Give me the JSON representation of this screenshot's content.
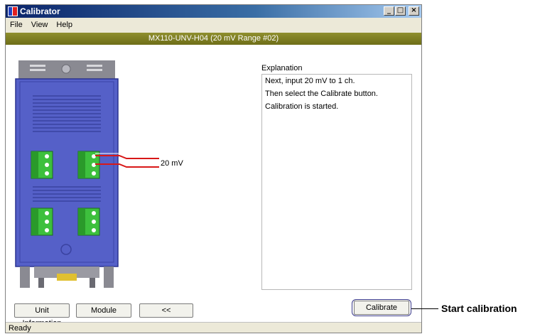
{
  "window": {
    "title": "Calibrator",
    "buttons": {
      "minimize": "_",
      "maximize": "□",
      "close": "×"
    }
  },
  "menu": [
    "File",
    "View",
    "Help"
  ],
  "module_header": "MX110-UNV-H04 (20 mV Range #02)",
  "diagram": {
    "signal_label": "20 mV"
  },
  "explanation": {
    "label": "Explanation",
    "lines": [
      "Next, input 20 mV to 1 ch.",
      "Then select the Calibrate button.",
      "Calibration is started."
    ]
  },
  "buttons": {
    "unit_information": "Unit Information",
    "module": "Module",
    "back": "<<",
    "calibrate": "Calibrate"
  },
  "status": "Ready",
  "annotation": "Start calibration",
  "colors": {
    "module_body": "#5560c8",
    "terminal_green": "#3dc03d",
    "wire_red": "#d81818",
    "header_olive": "#7c7c22"
  }
}
